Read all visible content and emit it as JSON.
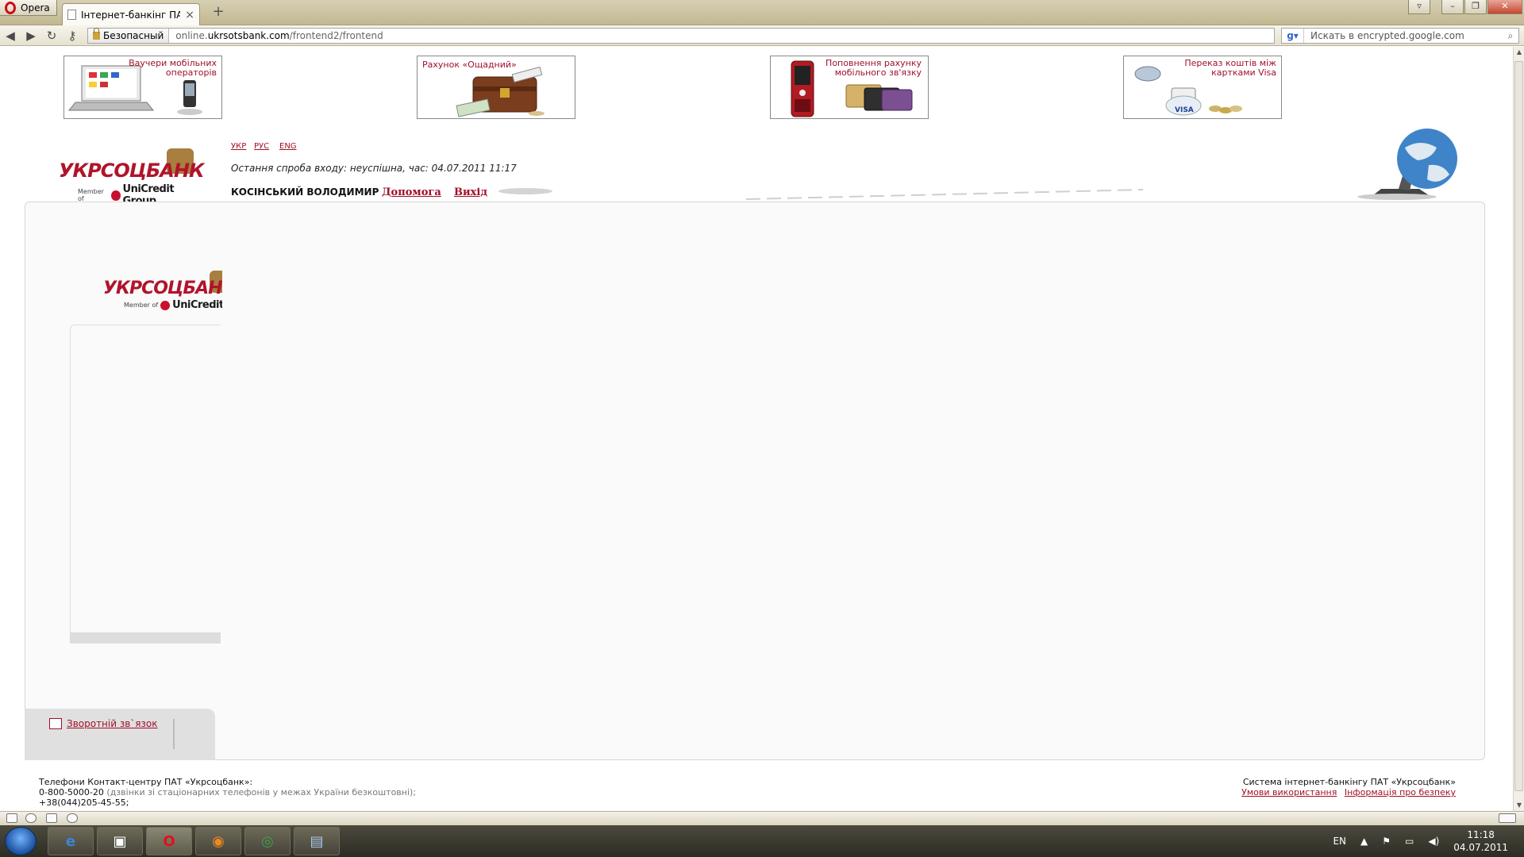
{
  "browser": {
    "menu_label": "Opera",
    "tab_title": "Інтернет-банкінг ПАТ...",
    "secure_label": "Безопасный",
    "url_prefix": "online.",
    "url_domain": "ukrsotsbank.com",
    "url_path": "/frontend2/frontend",
    "search_placeholder": "Искать в encrypted.google.com",
    "search_engine_icon": "google-icon"
  },
  "banners": [
    {
      "label_line1": "Ваучери мобільних",
      "label_line2": "операторів"
    },
    {
      "label_line1": "Рахунок «Ощадний»",
      "label_line2": ""
    },
    {
      "label_line1": "Поповнення рахунку",
      "label_line2": "мобільного зв'язку"
    },
    {
      "label_line1": "Переказ коштів між",
      "label_line2": "картками Visa"
    }
  ],
  "header": {
    "logo_word": "УКРСОЦБАНК",
    "logo_member": "Member of",
    "logo_group": "UniCredit Group",
    "languages": [
      "УКР",
      "РУС",
      "ENG"
    ],
    "last_login": "Остання спроба входу: неуспішна, час: 04.07.2011 11:17",
    "username": "КОСІНСЬКИЙ ВОЛОДИМИР",
    "help_link": "Допомога",
    "logout_link": "Вихід"
  },
  "inner_logo": {
    "word": "УКРСОЦБАНК",
    "member": "Member of",
    "group": "UniCredit G"
  },
  "sidebar": {
    "feedback_link": "Зворотній зв`язок"
  },
  "footer": {
    "contact_title": "Телефони Контакт-центру ПАТ «Укрсоцбанк»:",
    "phone1": "0-800-5000-20",
    "phone1_note": " (дзвінки зі стаціонарних телефонів у межах України безкоштовні);",
    "phone2": "+38(044)205-45-55;",
    "system_title": "Система інтернет-банкінгу ПАТ «Укрсоцбанк»",
    "terms_link": "Умови використання",
    "security_link": "Інформація про безпеку"
  },
  "taskbar": {
    "language": "EN",
    "time": "11:18",
    "date": "04.07.2011"
  },
  "colors": {
    "brand": "#b0142b",
    "link": "#a0102a"
  }
}
